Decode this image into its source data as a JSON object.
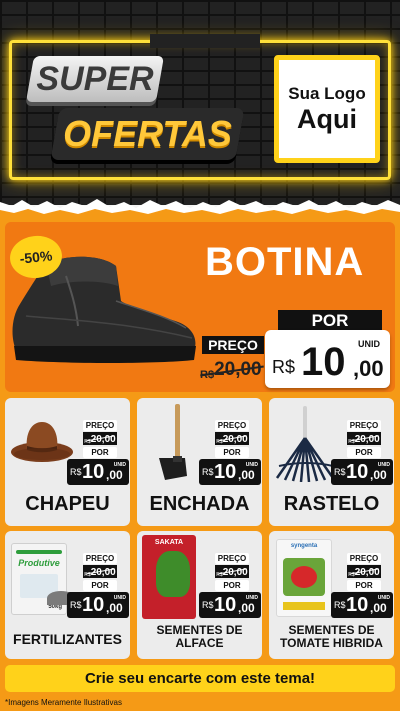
{
  "header": {
    "super": "SUPER",
    "ofertas": "OFERTAS",
    "logo_line1": "Sua Logo",
    "logo_line2": "Aqui"
  },
  "hero": {
    "discount": "-50%",
    "title": "BOTINA",
    "por": "POR",
    "preco": "PREÇO",
    "old_currency": "R$",
    "old_price": "20,00",
    "unid": "UNID",
    "currency": "R$",
    "price_int": "10",
    "price_dec": ",00",
    "image": "botina-icon"
  },
  "products": [
    {
      "name": "CHAPEU",
      "icon": "hat-icon",
      "preco": "PREÇO",
      "old_currency": "R$",
      "old_price": "20,00",
      "por": "POR",
      "currency": "R$",
      "price_int": "10",
      "price_dec": ",00",
      "unid": "UNID"
    },
    {
      "name": "ENCHADA",
      "icon": "hoe-icon",
      "preco": "PREÇO",
      "old_currency": "R$",
      "old_price": "20,00",
      "por": "POR",
      "currency": "R$",
      "price_int": "10",
      "price_dec": ",00",
      "unid": "UNID"
    },
    {
      "name": "RASTELO",
      "icon": "rake-icon",
      "preco": "PREÇO",
      "old_currency": "R$",
      "old_price": "20,00",
      "por": "POR",
      "currency": "R$",
      "price_int": "10",
      "price_dec": ",00",
      "unid": "UNID"
    },
    {
      "name": "FERTILIZANTES",
      "icon": "fertilizer-bag-icon",
      "bag_label": "Produtive",
      "bag_weight": "50kg",
      "preco": "PREÇO",
      "old_currency": "R$",
      "old_price": "20,00",
      "por": "POR",
      "currency": "R$",
      "price_int": "10",
      "price_dec": ",00",
      "unid": "UNID"
    },
    {
      "name_line1": "SEMENTES DE",
      "name_line2": "ALFACE",
      "icon": "seed-packet-icon",
      "pack_label": "SAKATA",
      "preco": "PREÇO",
      "old_currency": "R$",
      "old_price": "20,00",
      "por": "POR",
      "currency": "R$",
      "price_int": "10",
      "price_dec": ",00",
      "unid": "UNID"
    },
    {
      "name_line1": "SEMENTES DE",
      "name_line2": "TOMATE HIBRIDA",
      "icon": "seed-packet-tomato-icon",
      "pack_label": "syngenta",
      "preco": "PREÇO",
      "old_currency": "R$",
      "old_price": "20,00",
      "por": "POR",
      "currency": "R$",
      "price_int": "10",
      "price_dec": ",00",
      "unid": "UNID"
    }
  ],
  "footer": {
    "cta": "Crie seu encarte com este tema!",
    "disclaimer": "*Imagens Meramente Ilustrativas"
  },
  "colors": {
    "orange": "#f59a16",
    "hero_orange": "#f17912",
    "yellow": "#ffd21a",
    "dark": "#111111"
  }
}
